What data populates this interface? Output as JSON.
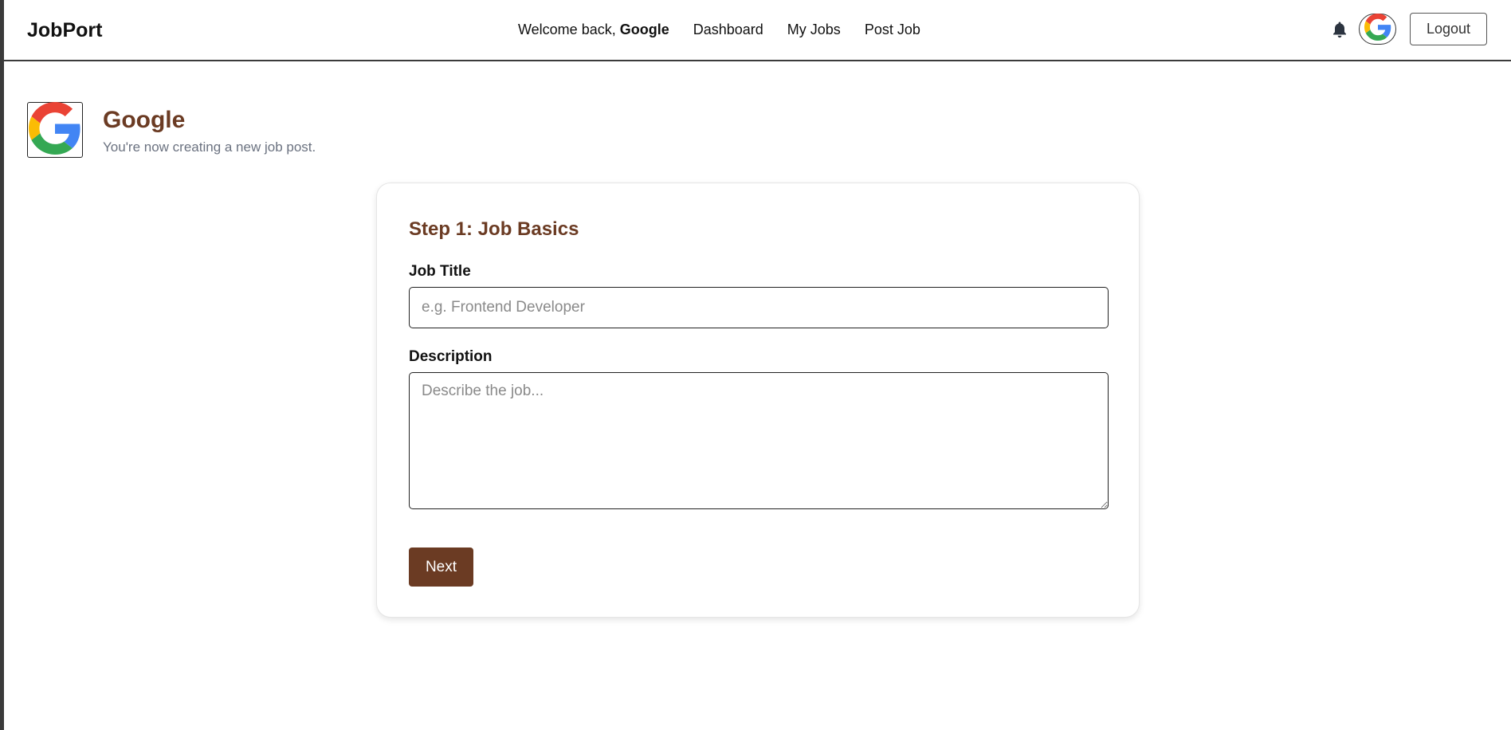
{
  "brand": "JobPort",
  "nav": {
    "welcome_prefix": "Welcome back, ",
    "welcome_name": "Google",
    "links": [
      "Dashboard",
      "My Jobs",
      "Post Job"
    ],
    "logout_label": "Logout"
  },
  "icons": {
    "bell": "bell-icon",
    "avatar": "google-logo-icon"
  },
  "company": {
    "name": "Google",
    "subtitle": "You're now creating a new job post."
  },
  "form": {
    "step_title": "Step 1: Job Basics",
    "title_label": "Job Title",
    "title_placeholder": "e.g. Frontend Developer",
    "title_value": "",
    "description_label": "Description",
    "description_placeholder": "Describe the job...",
    "description_value": "",
    "next_label": "Next"
  },
  "colors": {
    "accent": "#6b3b23",
    "google_blue": "#4285F4",
    "google_red": "#EA4335",
    "google_yellow": "#FBBC05",
    "google_green": "#34A853"
  }
}
